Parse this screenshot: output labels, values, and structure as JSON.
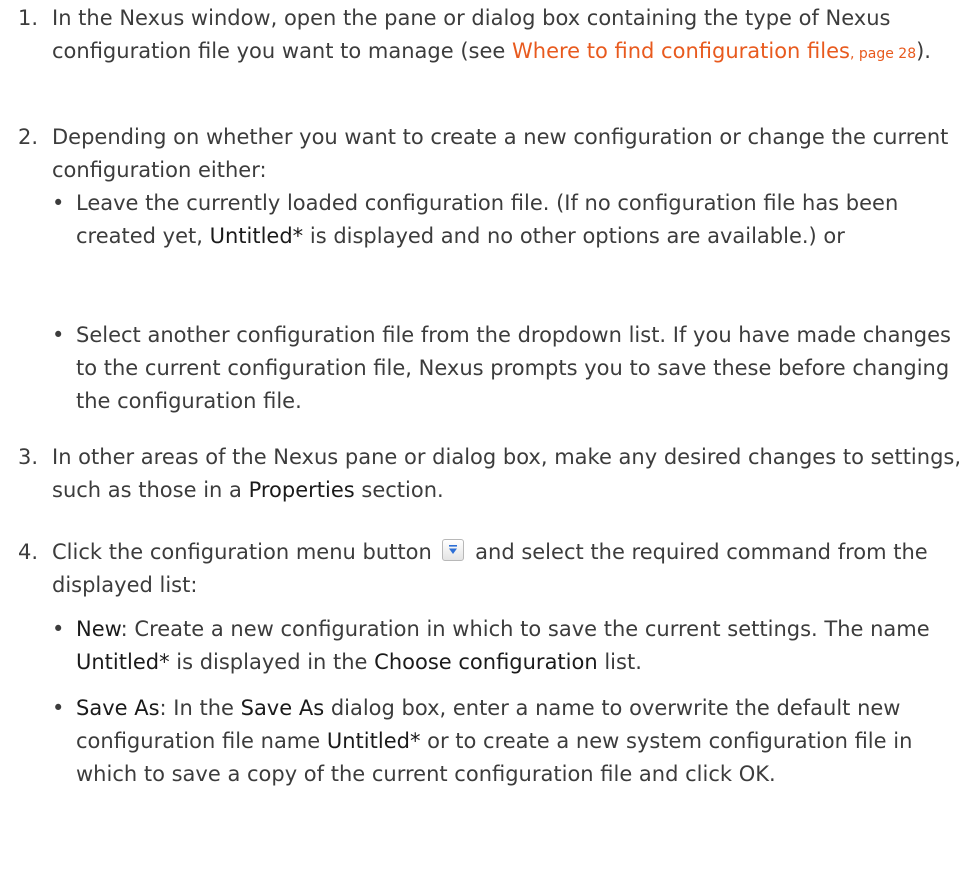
{
  "step1": {
    "num": "1.",
    "text_a": "In the Nexus window, open the pane or dialog box containing the type of Nexus configuration file you want to manage (see ",
    "link_text": "Where to find configuration files",
    "link_page": ", page 28",
    "text_b": ")."
  },
  "step2": {
    "num": "2.",
    "text": "Depending on whether you want to create a new configuration or change the current configuration either:",
    "bullet1": {
      "text_a": "Leave the currently loaded configuration file. (If no configuration file has been created yet, ",
      "bold": "Untitled*",
      "text_b": " is displayed and no other options are available.) or"
    },
    "bullet2": {
      "text": "Select another configuration file from the dropdown list. If you have made changes to the current configuration file, Nexus prompts you to save these before changing the configuration file."
    }
  },
  "step3": {
    "num": "3.",
    "text_a": "In other areas of the Nexus pane or dialog box, make any desired changes to settings, such as those in a ",
    "bold": "Properties",
    "text_b": " section."
  },
  "step4": {
    "num": "4.",
    "text_a": "Click the configuration menu button",
    "text_b": "and select the required command from the displayed list:",
    "bullet1": {
      "bold1": "New",
      "text_a": ": Create a new configuration in which to save the current settings. The name ",
      "bold2": "Untitled*",
      "text_b": " is displayed in the ",
      "bold3": "Choose configuration",
      "text_c": " list."
    },
    "bullet2": {
      "bold1": "Save As",
      "text_a": ": In the ",
      "bold2": "Save As",
      "text_b": " dialog box, enter a name to overwrite the default new configuration file name ",
      "bold3": "Untitled*",
      "text_c": " or to create a new system configuration file in which to save a copy of the current configuration file and click OK."
    }
  },
  "bullet_char": "•",
  "menu_button_icon": "dropdown-arrow-icon",
  "colors": {
    "link": "#e85a1e",
    "icon_blue": "#2d6fd6",
    "text": "#3c3c3c"
  }
}
